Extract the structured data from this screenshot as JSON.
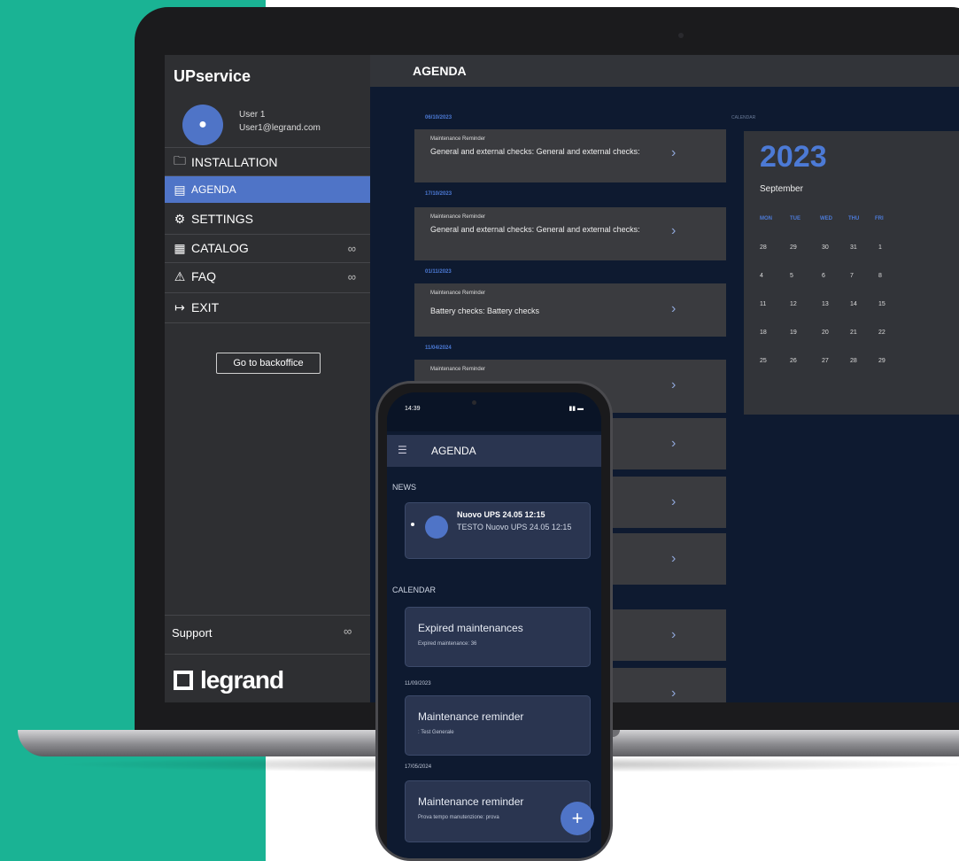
{
  "sidebar": {
    "app_title": "UPservice",
    "user": {
      "name": "User 1",
      "email": "User1@legrand.com"
    },
    "items": [
      {
        "label": "INSTALLATION",
        "icon": "folder-icon"
      },
      {
        "label": "AGENDA",
        "icon": "calendar-icon",
        "active": true
      },
      {
        "label": "SETTINGS",
        "icon": "gear-icon"
      },
      {
        "label": "CATALOG",
        "icon": "catalog-icon"
      },
      {
        "label": "FAQ",
        "icon": "warning-icon"
      },
      {
        "label": "EXIT",
        "icon": "exit-icon"
      }
    ],
    "backoffice_label": "Go to backoffice",
    "support_label": "Support",
    "logo_text": "legrand"
  },
  "header": {
    "title": "AGENDA"
  },
  "agenda": {
    "entries": [
      {
        "date": "06/10/2023",
        "kind": "Maintenance Reminder",
        "text": "General and external checks: General and external checks:"
      },
      {
        "date": "17/10/2023",
        "kind": "Maintenance Reminder",
        "text": "General and external checks: General and external checks:"
      },
      {
        "date": "01/11/2023",
        "kind": "Maintenance Reminder",
        "text": "Battery checks: Battery checks"
      },
      {
        "date": "11/04/2024",
        "kind": "Maintenance Reminder",
        "text": ""
      }
    ]
  },
  "calendar": {
    "section_label": "CALENDAR",
    "year": "2023",
    "month": "September",
    "weekdays": [
      "MON",
      "TUE",
      "WED",
      "THU",
      "FRI"
    ],
    "weeks": [
      [
        "28",
        "29",
        "30",
        "31",
        "1"
      ],
      [
        "4",
        "5",
        "6",
        "7",
        "8"
      ],
      [
        "11",
        "12",
        "13",
        "14",
        "15"
      ],
      [
        "18",
        "19",
        "20",
        "21",
        "22"
      ],
      [
        "25",
        "26",
        "27",
        "28",
        "29"
      ]
    ]
  },
  "phone": {
    "time": "14:39",
    "title": "AGENDA",
    "news_section": "NEWS",
    "news": {
      "title": "Nuovo UPS 24.05 12:15",
      "text": "TESTO Nuovo UPS 24.05 12:15"
    },
    "calendar_section": "CALENDAR",
    "expired": {
      "title": "Expired maintenances",
      "text": "Expired maintenance: 36"
    },
    "reminders": [
      {
        "date": "11/09/2023",
        "title": "Maintenance reminder",
        "text": ": Test Generale"
      },
      {
        "date": "17/05/2024",
        "title": "Maintenance reminder",
        "text": "Prova tempo manutenzione: prova"
      }
    ],
    "fab_label": "+"
  },
  "colors": {
    "teal": "#1ab394",
    "accent": "#4f74c7",
    "screen_bg": "#0e1a30",
    "sidebar_bg": "#2e2f32",
    "card_bg": "#3a3b3f"
  }
}
